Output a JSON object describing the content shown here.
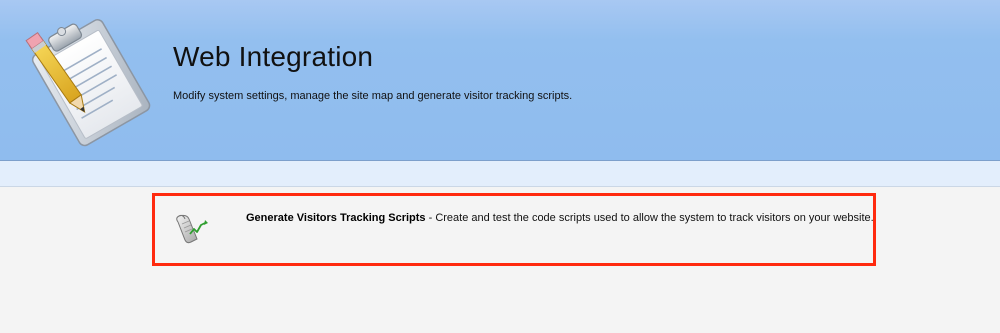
{
  "header": {
    "title": "Web Integration",
    "subtitle": "Modify system settings, manage the site map and generate visitor tracking scripts.",
    "icon": "clipboard-pencil-icon"
  },
  "features": [
    {
      "icon": "tracking-script-icon",
      "link_label": "Generate Visitors Tracking Scripts",
      "separator": " - ",
      "description": "Create and test the code scripts used to allow the system to track visitors on your website."
    }
  ],
  "colors": {
    "header_bg": "#8fbcee",
    "strip_bg": "#e3eefc",
    "content_bg": "#f4f4f4",
    "highlight_border": "#ff2a0e"
  }
}
